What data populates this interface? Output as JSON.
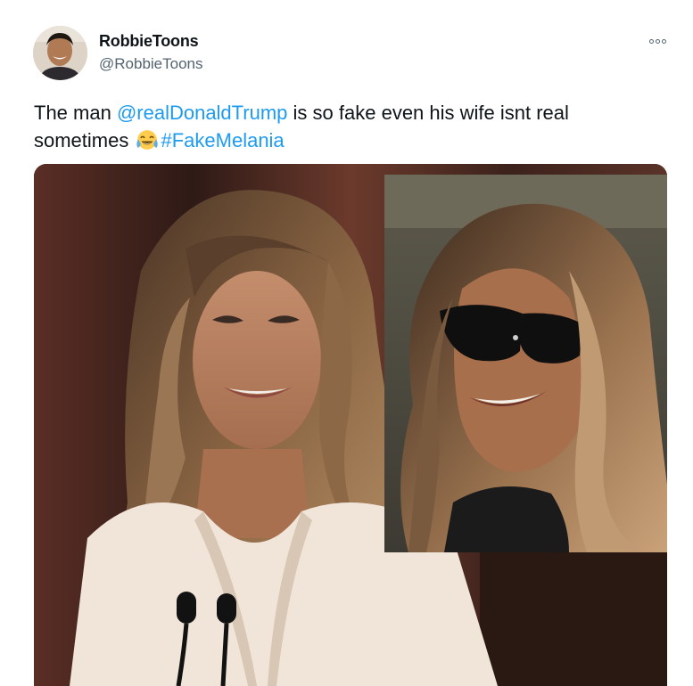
{
  "tweet": {
    "author": {
      "display_name": "RobbieToons",
      "handle": "@RobbieToons",
      "avatar": "avatar-photo"
    },
    "more_icon": "more-horizontal-icon",
    "text": {
      "part1": "The man ",
      "mention": "@realDonaldTrump",
      "part2": " is so fake even his wife isnt real sometimes ",
      "emoji": "😂",
      "emoji_name": "face-with-tears-of-joy",
      "hashtag": "#FakeMelania"
    },
    "media": {
      "image": "tweet-photo-collage",
      "panels": [
        "photo-smiling-woman",
        "photo-woman-sunglasses"
      ]
    }
  },
  "colors": {
    "text_primary": "#0f1419",
    "text_secondary": "#536471",
    "link": "#1d9bf0"
  }
}
